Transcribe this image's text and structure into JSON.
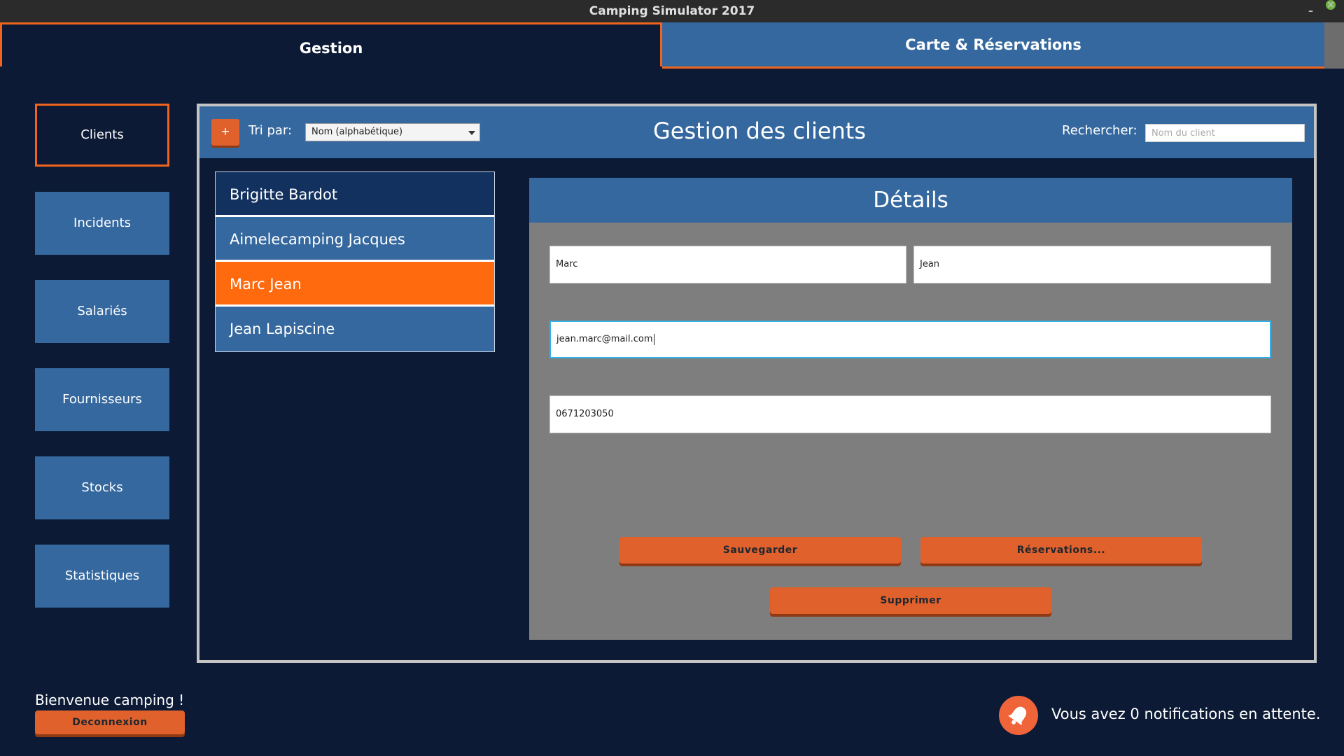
{
  "window": {
    "title": "Camping Simulator 2017",
    "minimize_glyph": "–",
    "close_glyph": "×"
  },
  "tabs": [
    {
      "label": "Gestion",
      "active": true
    },
    {
      "label": "Carte & Réservations",
      "active": false
    }
  ],
  "sidebar": {
    "items": [
      {
        "label": "Clients",
        "active": true
      },
      {
        "label": "Incidents"
      },
      {
        "label": "Salariés"
      },
      {
        "label": "Fournisseurs"
      },
      {
        "label": "Stocks"
      },
      {
        "label": "Statistiques"
      }
    ]
  },
  "toolbar": {
    "add_label": "+",
    "sort_label": "Tri par:",
    "sort_value": "Nom (alphabétique)",
    "title": "Gestion des clients",
    "search_label": "Rechercher:",
    "search_placeholder": "Nom du client",
    "search_value": ""
  },
  "clients": [
    {
      "name": "Brigitte Bardot"
    },
    {
      "name": "Aimelecamping Jacques"
    },
    {
      "name": "Marc Jean",
      "selected": true
    },
    {
      "name": "Jean Lapiscine"
    }
  ],
  "details": {
    "title": "Détails",
    "first_name": "Marc",
    "last_name": "Jean",
    "email": "jean.marc@mail.com",
    "phone": "0671203050",
    "save_label": "Sauvegarder",
    "reservations_label": "Réservations...",
    "delete_label": "Supprimer"
  },
  "footer": {
    "welcome": "Bienvenue camping !",
    "logout_label": "Deconnexion",
    "notifications_text": "Vous avez 0 notifications en attente."
  },
  "colors": {
    "background": "#0c1a35",
    "panel_blue": "#35689e",
    "accent_orange": "#f0641e",
    "selected_item": "#ff6a0f",
    "details_bg": "#7e7e7e"
  },
  "icons": {
    "notification": "bell-icon"
  }
}
